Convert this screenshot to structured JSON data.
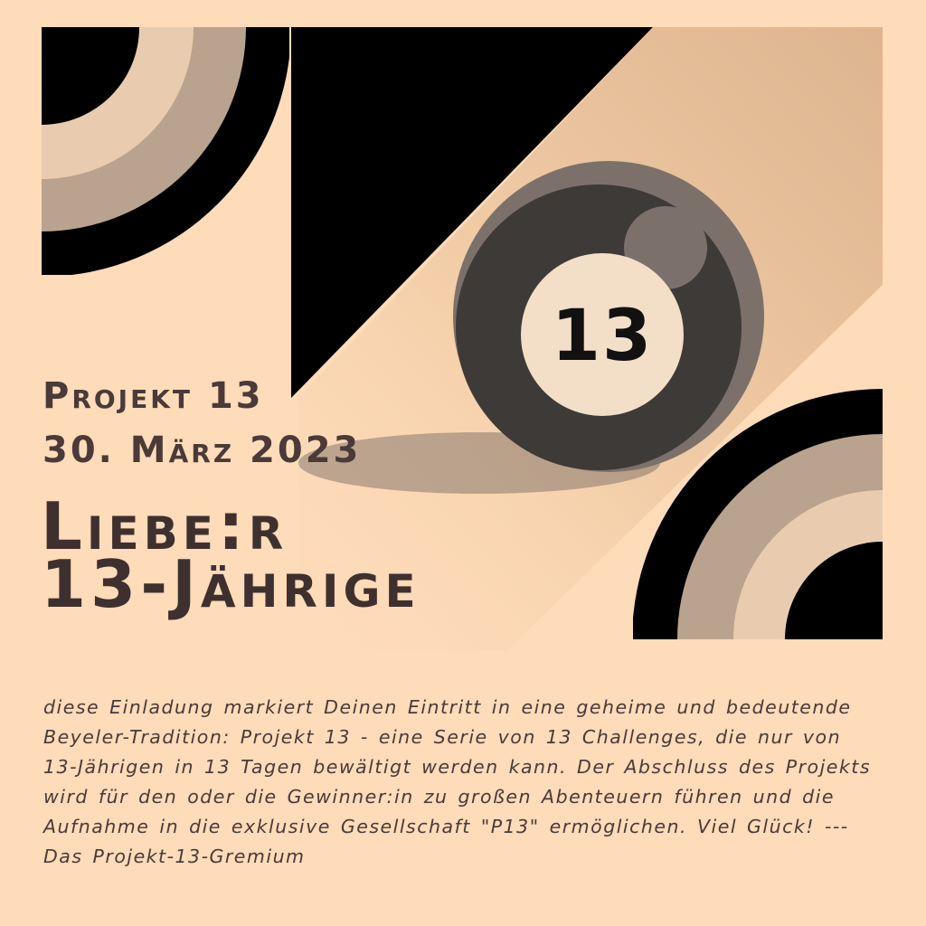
{
  "ball": {
    "number": "13"
  },
  "header": {
    "project": "Projekt 13",
    "date": "30. März 2023"
  },
  "greeting": {
    "line1": "Liebe:r",
    "line2": "13-Jährige"
  },
  "body": {
    "text": "diese Einladung markiert Deinen Eintritt in eine geheime und bedeutende Beyeler-Tradition: Projekt 13 - eine Serie von 13 Challenges, die nur von 13-Jährigen in 13 Tagen bewältigt werden kann. Der Abschluss des Projekts wird für den oder die Gewinner:in zu großen Abenteuern führen und die Aufnahme in die exklusive Gesellschaft \"P13\" ermöglichen. Viel Glück!  --- Das Projekt-13-Gremium"
  },
  "colors": {
    "background": "#fedbb9",
    "black": "#000000",
    "dark_ring": "#b9a38f",
    "light_ring": "#e9ccaf",
    "ball_dark": "#3e3a37",
    "ball_grey": "#7c716a",
    "text": "#4a3a38"
  }
}
